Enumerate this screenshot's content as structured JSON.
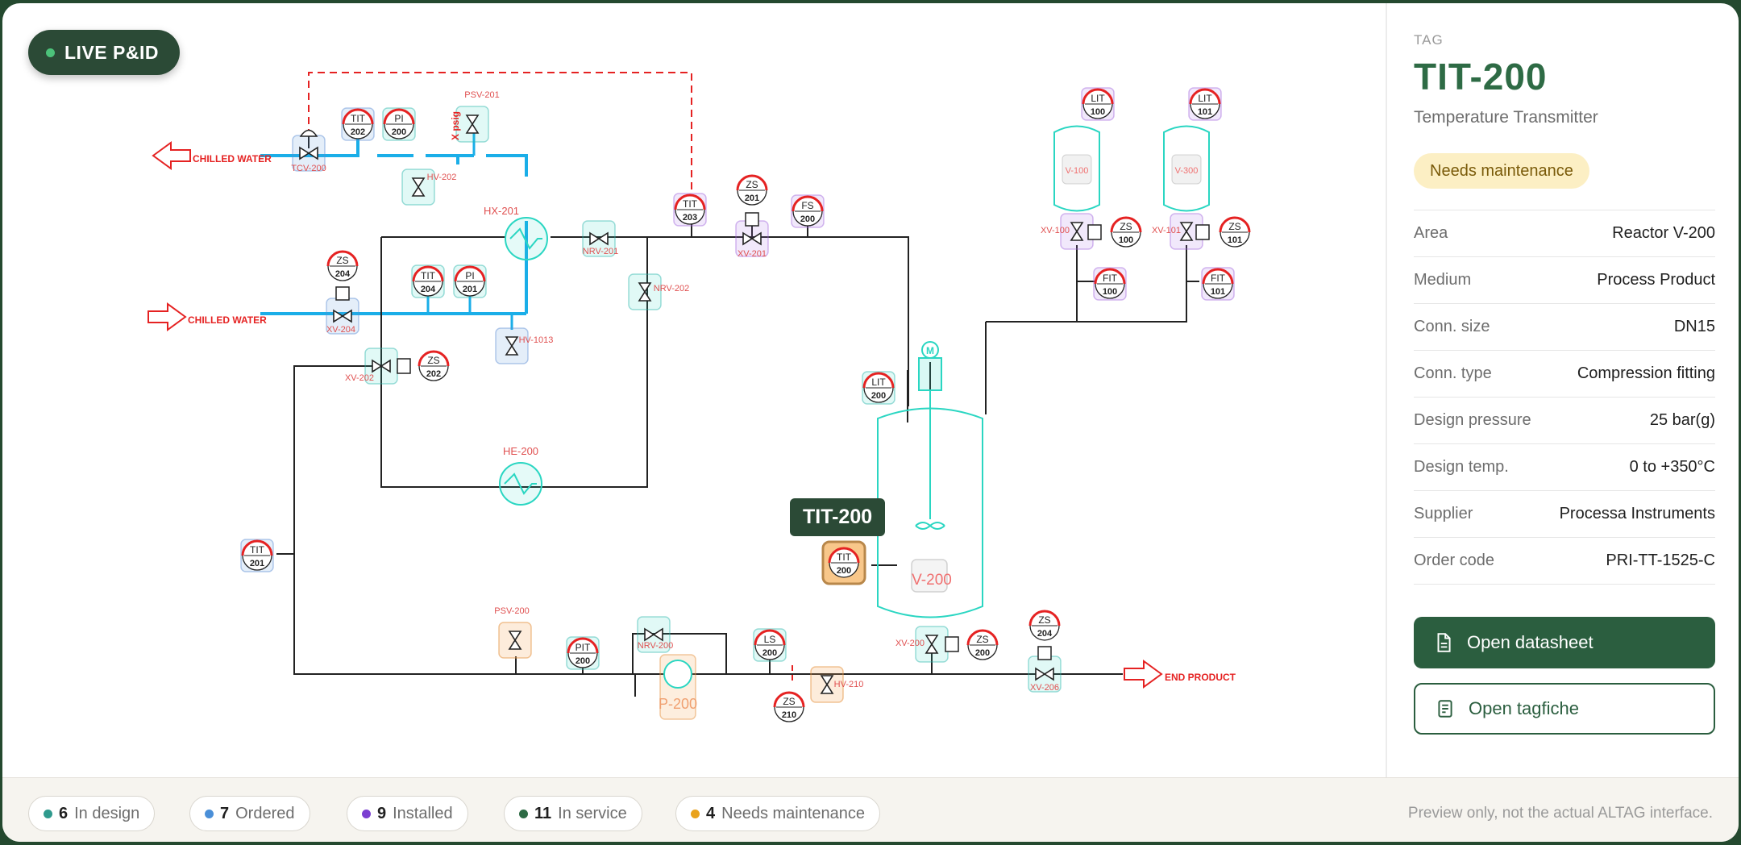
{
  "live_label": "LIVE P&ID",
  "tooltip": "TIT-200",
  "diagram": {
    "stream_in_top": "CHILLED WATER",
    "stream_in_bottom": "CHILLED WATER",
    "stream_out": "END PRODUCT",
    "psv_note": "X psig",
    "equipment": {
      "hx201": "HX-201",
      "he200": "HE-200",
      "p200": "P-200",
      "v200": "V-200",
      "v100": "V-100",
      "v300": "V-300",
      "motor": "M"
    },
    "valves": {
      "tcv200": "TCV-200",
      "hv202": "HV-202",
      "psv201": "PSV-201",
      "nrv201": "NRV-201",
      "nrv202": "NRV-202",
      "xv201": "XV-201",
      "xv204": "XV-204",
      "hv1013": "HV-1013",
      "xv202": "XV-202",
      "psv200": "PSV-200",
      "nrv200": "NRV-200",
      "hv210": "HV-210",
      "xv200": "XV-200",
      "xv206": "XV-206",
      "xv100": "XV-100",
      "xv101": "XV-101"
    },
    "instruments": [
      {
        "id": "tit202",
        "top": "TIT",
        "num": "202"
      },
      {
        "id": "pi200",
        "top": "PI",
        "num": "200"
      },
      {
        "id": "tit203",
        "top": "TIT",
        "num": "203"
      },
      {
        "id": "zs201",
        "top": "ZS",
        "num": "201"
      },
      {
        "id": "fs200",
        "top": "FS",
        "num": "200"
      },
      {
        "id": "zs204a",
        "top": "ZS",
        "num": "204"
      },
      {
        "id": "tit204",
        "top": "TIT",
        "num": "204"
      },
      {
        "id": "pi201",
        "top": "PI",
        "num": "201"
      },
      {
        "id": "zs202",
        "top": "ZS",
        "num": "202"
      },
      {
        "id": "lit200",
        "top": "LIT",
        "num": "200"
      },
      {
        "id": "tit200",
        "top": "TIT",
        "num": "200"
      },
      {
        "id": "tit201",
        "top": "TIT",
        "num": "201"
      },
      {
        "id": "pit200",
        "top": "PIT",
        "num": "200"
      },
      {
        "id": "ls200",
        "top": "LS",
        "num": "200"
      },
      {
        "id": "zs210",
        "top": "ZS",
        "num": "210"
      },
      {
        "id": "zs200",
        "top": "ZS",
        "num": "200"
      },
      {
        "id": "zs204b",
        "top": "ZS",
        "num": "204"
      },
      {
        "id": "lit100",
        "top": "LIT",
        "num": "100"
      },
      {
        "id": "lit101",
        "top": "LIT",
        "num": "101"
      },
      {
        "id": "zs100",
        "top": "ZS",
        "num": "100"
      },
      {
        "id": "zs101",
        "top": "ZS",
        "num": "101"
      },
      {
        "id": "fit100",
        "top": "FIT",
        "num": "100"
      },
      {
        "id": "fit101",
        "top": "FIT",
        "num": "101"
      }
    ]
  },
  "sidebar": {
    "caption": "TAG",
    "tag": "TIT-200",
    "description": "Temperature Transmitter",
    "status": "Needs maintenance",
    "properties": [
      {
        "label": "Area",
        "value": "Reactor V-200"
      },
      {
        "label": "Medium",
        "value": "Process Product"
      },
      {
        "label": "Conn. size",
        "value": "DN15"
      },
      {
        "label": "Conn. type",
        "value": "Compression fitting"
      },
      {
        "label": "Design pressure",
        "value": "25 bar(g)"
      },
      {
        "label": "Design temp.",
        "value": "0 to +350°C"
      },
      {
        "label": "Supplier",
        "value": "Processa Instruments"
      },
      {
        "label": "Order code",
        "value": "PRI-TT-1525-C"
      }
    ],
    "open_datasheet": "Open datasheet",
    "open_tagfiche": "Open tagfiche"
  },
  "footer": {
    "chips": [
      {
        "count": "6",
        "label": "In design",
        "color": "#2f9a8d"
      },
      {
        "count": "7",
        "label": "Ordered",
        "color": "#4a8fd8"
      },
      {
        "count": "9",
        "label": "Installed",
        "color": "#7b3fd1"
      },
      {
        "count": "11",
        "label": "In service",
        "color": "#2e6b45"
      },
      {
        "count": "4",
        "label": "Needs maintenance",
        "color": "#e9a21b"
      }
    ],
    "note": "Preview only, not the actual ALTAG interface."
  },
  "colors": {
    "brand": "#2b4a36",
    "accent": "#2e6b45",
    "water": "#1aaee8",
    "equipment": "#2ad6c2",
    "alarm": "#e52222"
  }
}
